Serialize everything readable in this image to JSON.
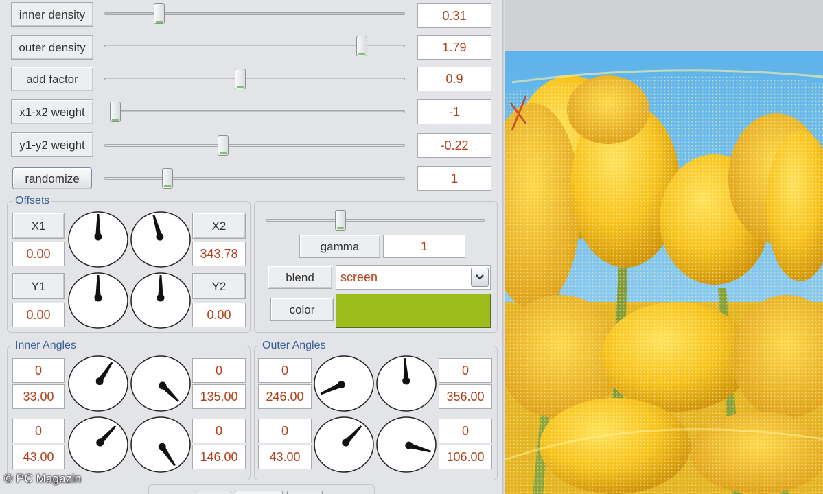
{
  "params": [
    {
      "label": "inner density",
      "value": "0.31",
      "fraction": 0.17
    },
    {
      "label": "outer density",
      "value": "1.79",
      "fraction": 0.87
    },
    {
      "label": "add factor",
      "value": "0.9",
      "fraction": 0.45
    },
    {
      "label": "x1-x2 weight",
      "value": "-1",
      "fraction": 0.0
    },
    {
      "label": "y1-y2 weight",
      "value": "-0.22",
      "fraction": 0.39
    },
    {
      "label": "randomize",
      "value": "1",
      "fraction": 0.2
    }
  ],
  "offsets": {
    "title": "Offsets",
    "x1": {
      "label": "X1",
      "value": "0.00"
    },
    "x2": {
      "label": "X2",
      "value": "343.78"
    },
    "y1": {
      "label": "Y1",
      "value": "0.00"
    },
    "y2": {
      "label": "Y2",
      "value": "0.00"
    },
    "dials": [
      0,
      344,
      0,
      0
    ]
  },
  "gamma": {
    "label": "gamma",
    "value": "1",
    "fraction": 0.33
  },
  "blend": {
    "label": "blend",
    "value": "screen"
  },
  "color": {
    "label": "color",
    "hex": "#9dbd1c"
  },
  "inner_angles": {
    "title": "Inner Angles",
    "rows": [
      {
        "start": "0",
        "left_value": "33.00",
        "end": "0",
        "right_value": "135.00",
        "left_dial": 33,
        "right_dial": 135
      },
      {
        "start": "0",
        "left_value": "43.00",
        "end": "0",
        "right_value": "146.00",
        "left_dial": 43,
        "right_dial": 146
      }
    ]
  },
  "outer_angles": {
    "title": "Outer Angles",
    "rows": [
      {
        "start": "0",
        "left_value": "246.00",
        "end": "0",
        "right_value": "356.00",
        "left_dial": 246,
        "right_dial": 356
      },
      {
        "start": "0",
        "left_value": "43.00",
        "end": "0",
        "right_value": "106.00",
        "left_dial": 43,
        "right_dial": 106
      }
    ]
  },
  "watermark": "© PC Magazin",
  "colors": {
    "accent_text": "#b3401c",
    "group_title": "#3a5f96"
  }
}
